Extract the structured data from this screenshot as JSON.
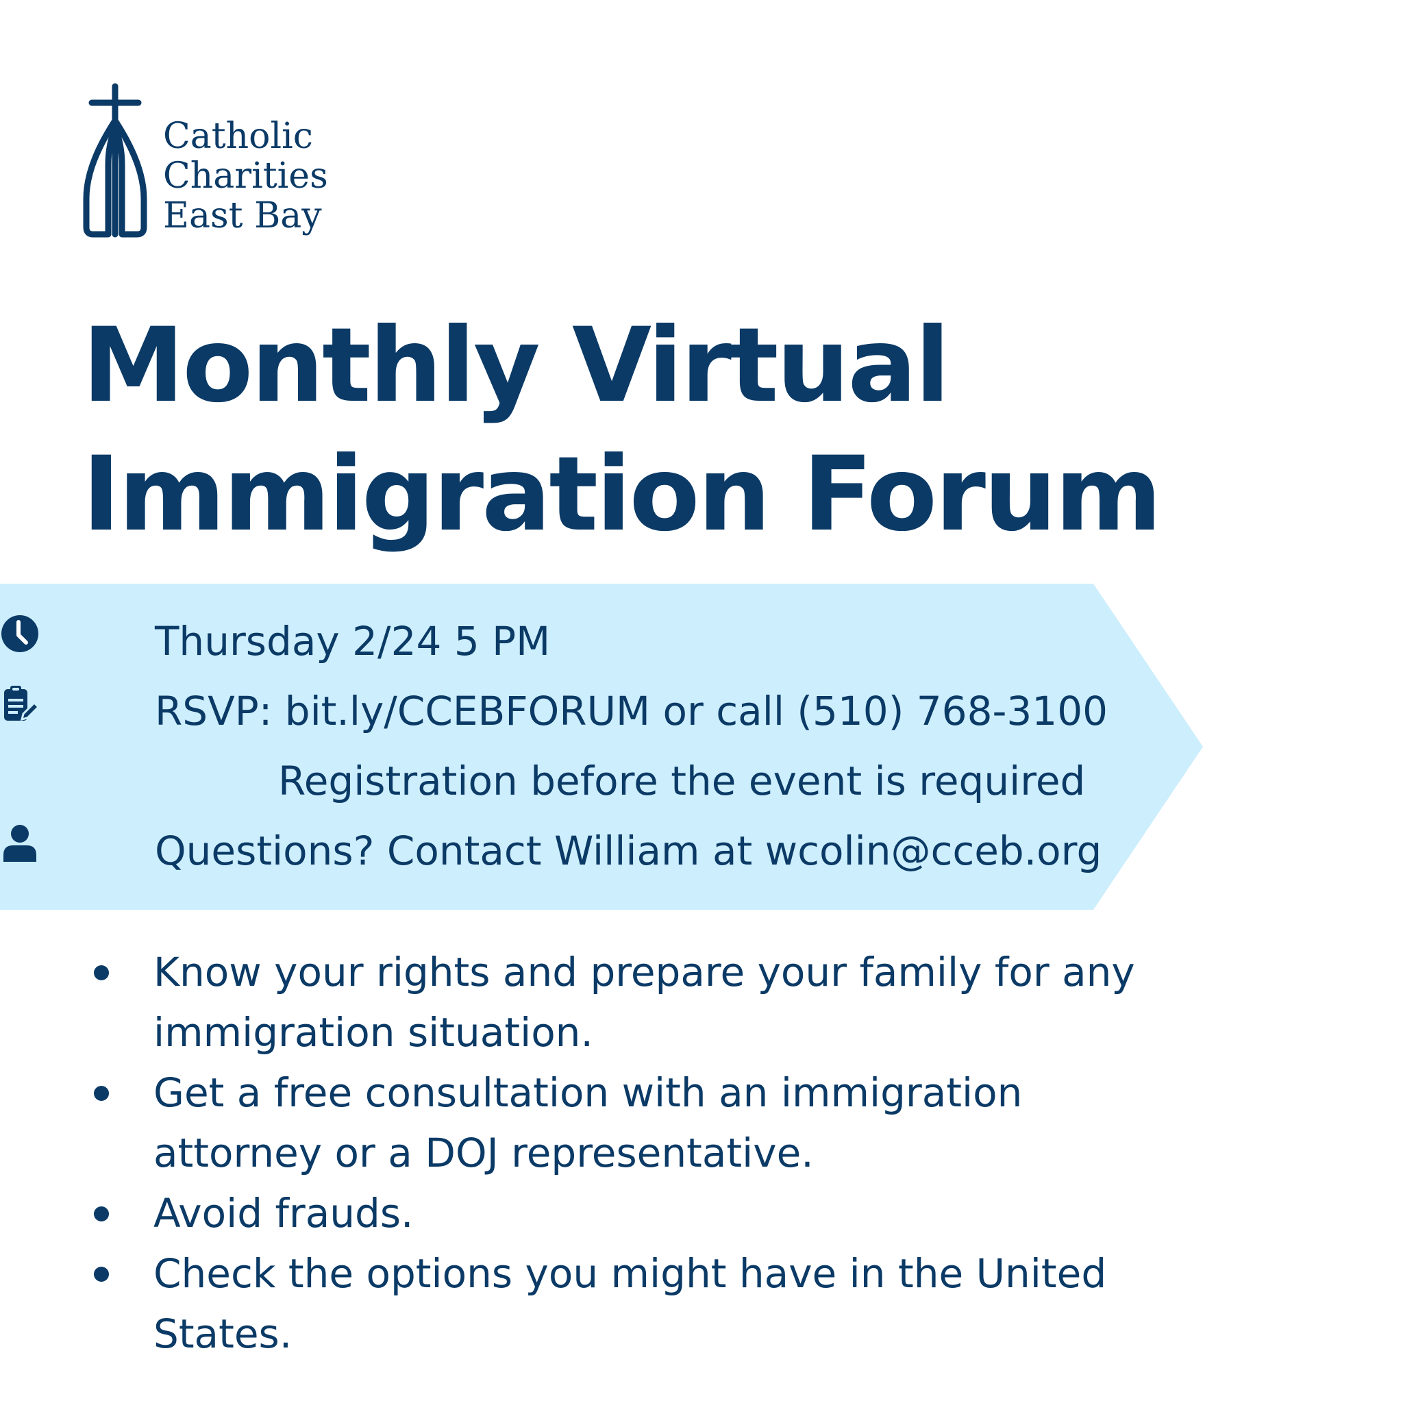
{
  "logo": {
    "mark_icon": "cross-church-icon",
    "line1": "Catholic",
    "line2": "Charities",
    "line3": "East Bay"
  },
  "title": {
    "line1": "Monthly Virtual",
    "line2": "Immigration Forum"
  },
  "info": {
    "date": {
      "icon": "clock-icon",
      "text": "Thursday 2/24 5 PM"
    },
    "rsvp": {
      "icon": "clipboard-edit-icon",
      "text": "RSVP: bit.ly/CCEBFORUM or call (510) 768-3100"
    },
    "registration_note": "Registration before the event is required",
    "contact": {
      "icon": "user-icon",
      "text": "Questions? Contact William at wcolin@cceb.org"
    }
  },
  "bullets": [
    "Know your rights and prepare your family for any immigration situation.",
    "Get a free consultation with an immigration attorney or a DOJ representative.",
    "Avoid frauds.",
    "Check the options you might have in the United States."
  ],
  "colors": {
    "primary": "#0b3a66",
    "banner": "#cdeefc",
    "background": "#ffffff"
  }
}
